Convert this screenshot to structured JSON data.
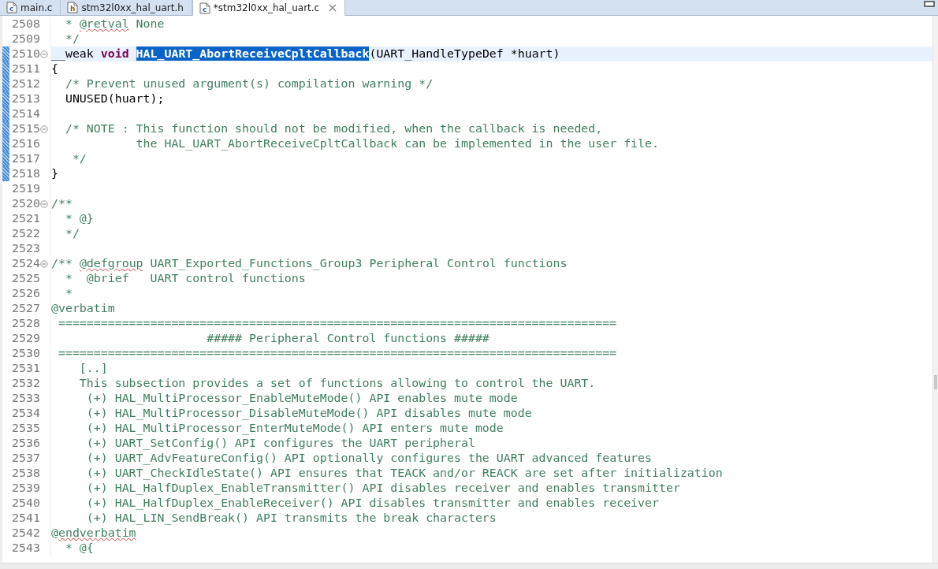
{
  "tabs": [
    {
      "label": "main.c",
      "file_type": "c",
      "selected": false
    },
    {
      "label": "stm32l0xx_hal_uart.h",
      "file_type": "h",
      "selected": false
    },
    {
      "label": "*stm32l0xx_hal_uart.c",
      "file_type": "c",
      "selected": true
    }
  ],
  "lines": [
    {
      "number": "2508",
      "changed": false,
      "current": false,
      "foldable": false,
      "tokens": [
        {
          "text": "  * ",
          "kind": "comment"
        },
        {
          "text": "@retval",
          "kind": "misspelled"
        },
        {
          "text": " None",
          "kind": "comment"
        }
      ]
    },
    {
      "number": "2509",
      "changed": false,
      "current": false,
      "foldable": false,
      "tokens": [
        {
          "text": "  */",
          "kind": "comment"
        }
      ]
    },
    {
      "number": "2510",
      "changed": true,
      "current": true,
      "foldable": true,
      "tokens": [
        {
          "text": "__weak ",
          "kind": "code"
        },
        {
          "text": "void ",
          "kind": "keyword"
        },
        {
          "text": "HAL_UART_AbortReceiveCpltCallback",
          "kind": "selection"
        },
        {
          "text": "(UART_HandleTypeDef *huart)",
          "kind": "code"
        }
      ]
    },
    {
      "number": "2511",
      "changed": true,
      "current": false,
      "foldable": false,
      "tokens": [
        {
          "text": "{",
          "kind": "code"
        }
      ]
    },
    {
      "number": "2512",
      "changed": true,
      "current": false,
      "foldable": false,
      "tokens": [
        {
          "text": "  /* Prevent unused argument(s) compilation warning */",
          "kind": "comment"
        }
      ]
    },
    {
      "number": "2513",
      "changed": true,
      "current": false,
      "foldable": false,
      "tokens": [
        {
          "text": "  UNUSED(huart);",
          "kind": "code"
        }
      ]
    },
    {
      "number": "2514",
      "changed": true,
      "current": false,
      "foldable": false
    },
    {
      "number": "2515",
      "changed": true,
      "current": false,
      "foldable": true,
      "tokens": [
        {
          "text": "  /* NOTE : This function should not be modified, when the callback is needed,",
          "kind": "comment"
        }
      ]
    },
    {
      "number": "2516",
      "changed": true,
      "current": false,
      "foldable": false,
      "tokens": [
        {
          "text": "            the HAL_UART_AbortReceiveCpltCallback can be implemented in the user file.",
          "kind": "comment"
        }
      ]
    },
    {
      "number": "2517",
      "changed": true,
      "current": false,
      "foldable": false,
      "tokens": [
        {
          "text": "   */",
          "kind": "comment"
        }
      ]
    },
    {
      "number": "2518",
      "changed": true,
      "current": false,
      "foldable": false,
      "tokens": [
        {
          "text": "}",
          "kind": "code"
        }
      ]
    },
    {
      "number": "2519",
      "changed": false,
      "current": false,
      "foldable": false
    },
    {
      "number": "2520",
      "changed": false,
      "current": false,
      "foldable": true,
      "tokens": [
        {
          "text": "/**",
          "kind": "comment"
        }
      ]
    },
    {
      "number": "2521",
      "changed": false,
      "current": false,
      "foldable": false,
      "tokens": [
        {
          "text": "  * @}",
          "kind": "comment"
        }
      ]
    },
    {
      "number": "2522",
      "changed": false,
      "current": false,
      "foldable": false,
      "tokens": [
        {
          "text": "  */",
          "kind": "comment"
        }
      ]
    },
    {
      "number": "2523",
      "changed": false,
      "current": false,
      "foldable": false
    },
    {
      "number": "2524",
      "changed": false,
      "current": false,
      "foldable": true,
      "tokens": [
        {
          "text": "/** ",
          "kind": "comment"
        },
        {
          "text": "@defgroup",
          "kind": "misspelled"
        },
        {
          "text": " UART_Exported_Functions_Group3 Peripheral Control functions",
          "kind": "comment"
        }
      ]
    },
    {
      "number": "2525",
      "changed": false,
      "current": false,
      "foldable": false,
      "tokens": [
        {
          "text": "  *  @brief   UART control functions",
          "kind": "comment"
        }
      ]
    },
    {
      "number": "2526",
      "changed": false,
      "current": false,
      "foldable": false,
      "tokens": [
        {
          "text": "  *",
          "kind": "comment"
        }
      ]
    },
    {
      "number": "2527",
      "changed": false,
      "current": false,
      "foldable": false,
      "tokens": [
        {
          "text": "@verbatim",
          "kind": "comment"
        }
      ]
    },
    {
      "number": "2528",
      "changed": false,
      "current": false,
      "foldable": false,
      "tokens": [
        {
          "text": " ===============================================================================",
          "kind": "comment"
        }
      ]
    },
    {
      "number": "2529",
      "changed": false,
      "current": false,
      "foldable": false,
      "tokens": [
        {
          "text": "                      ##### Peripheral Control functions #####",
          "kind": "comment"
        }
      ]
    },
    {
      "number": "2530",
      "changed": false,
      "current": false,
      "foldable": false,
      "tokens": [
        {
          "text": " ===============================================================================",
          "kind": "comment"
        }
      ]
    },
    {
      "number": "2531",
      "changed": false,
      "current": false,
      "foldable": false,
      "tokens": [
        {
          "text": "    [..]",
          "kind": "comment"
        }
      ]
    },
    {
      "number": "2532",
      "changed": false,
      "current": false,
      "foldable": false,
      "tokens": [
        {
          "text": "    This subsection provides a set of functions allowing to control the UART.",
          "kind": "comment"
        }
      ]
    },
    {
      "number": "2533",
      "changed": false,
      "current": false,
      "foldable": false,
      "tokens": [
        {
          "text": "     (+) HAL_MultiProcessor_EnableMuteMode() API enables mute mode",
          "kind": "comment"
        }
      ]
    },
    {
      "number": "2534",
      "changed": false,
      "current": false,
      "foldable": false,
      "tokens": [
        {
          "text": "     (+) HAL_MultiProcessor_DisableMuteMode() API disables mute mode",
          "kind": "comment"
        }
      ]
    },
    {
      "number": "2535",
      "changed": false,
      "current": false,
      "foldable": false,
      "tokens": [
        {
          "text": "     (+) HAL_MultiProcessor_EnterMuteMode() API enters mute mode",
          "kind": "comment"
        }
      ]
    },
    {
      "number": "2536",
      "changed": false,
      "current": false,
      "foldable": false,
      "tokens": [
        {
          "text": "     (+) UART_SetConfig() API configures the UART peripheral",
          "kind": "comment"
        }
      ]
    },
    {
      "number": "2537",
      "changed": false,
      "current": false,
      "foldable": false,
      "tokens": [
        {
          "text": "     (+) UART_AdvFeatureConfig() API optionally configures the UART advanced features",
          "kind": "comment"
        }
      ]
    },
    {
      "number": "2538",
      "changed": false,
      "current": false,
      "foldable": false,
      "tokens": [
        {
          "text": "     (+) UART_CheckIdleState() API ensures that TEACK and/or REACK are set after initialization",
          "kind": "comment"
        }
      ]
    },
    {
      "number": "2539",
      "changed": false,
      "current": false,
      "foldable": false,
      "tokens": [
        {
          "text": "     (+) HAL_HalfDuplex_EnableTransmitter() API disables receiver and enables transmitter",
          "kind": "comment"
        }
      ]
    },
    {
      "number": "2540",
      "changed": false,
      "current": false,
      "foldable": false,
      "tokens": [
        {
          "text": "     (+) HAL_HalfDuplex_EnableReceiver() API disables transmitter and enables receiver",
          "kind": "comment"
        }
      ]
    },
    {
      "number": "2541",
      "changed": false,
      "current": false,
      "foldable": false,
      "tokens": [
        {
          "text": "     (+) HAL_LIN_SendBreak() API transmits the break characters",
          "kind": "comment"
        }
      ]
    },
    {
      "number": "2542",
      "changed": false,
      "current": false,
      "foldable": false,
      "tokens": [
        {
          "text": "@",
          "kind": "comment"
        },
        {
          "text": "endverbatim",
          "kind": "misspelled"
        }
      ]
    },
    {
      "number": "2543",
      "changed": false,
      "current": false,
      "foldable": false,
      "tokens": [
        {
          "text": "  * @{",
          "kind": "comment"
        }
      ]
    }
  ]
}
